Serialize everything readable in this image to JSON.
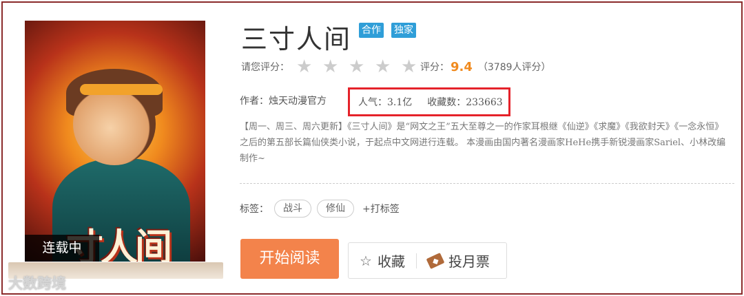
{
  "book": {
    "title": "三寸人间",
    "badges": [
      "合作",
      "独家"
    ],
    "cover_title": "寸人间",
    "status": "连载中"
  },
  "rating": {
    "prompt": "请您评分：",
    "stars": 5,
    "score_label": "评分：",
    "score": "9.4",
    "count": "（3789人评分）"
  },
  "meta": {
    "author_label": "作者：",
    "author": "烛天动漫官方",
    "popularity": "人气：3.1亿",
    "favorites": "收藏数：233663"
  },
  "description": "【周一、周三、周六更新】《三寸人间》是“网文之王”五大至尊之一的作家耳根继《仙逆》《求魔》《我欲封天》《一念永恒》之后的第五部长篇仙侠类小说，于起点中文网进行连载。 本漫画由国内著名漫画家HeHe携手新锐漫画家Sariel、小林改编制作~",
  "tags": {
    "label": "标签：",
    "items": [
      "战斗",
      "修仙"
    ],
    "add_label": "+打标签"
  },
  "actions": {
    "read": "开始阅读",
    "favorite": "收藏",
    "vote": "投月票"
  },
  "watermark": "大数跨境",
  "colors": {
    "accent": "#f3834b",
    "badge": "#2f9ed8",
    "score": "#f08a1e",
    "highlight": "#e5222a"
  }
}
